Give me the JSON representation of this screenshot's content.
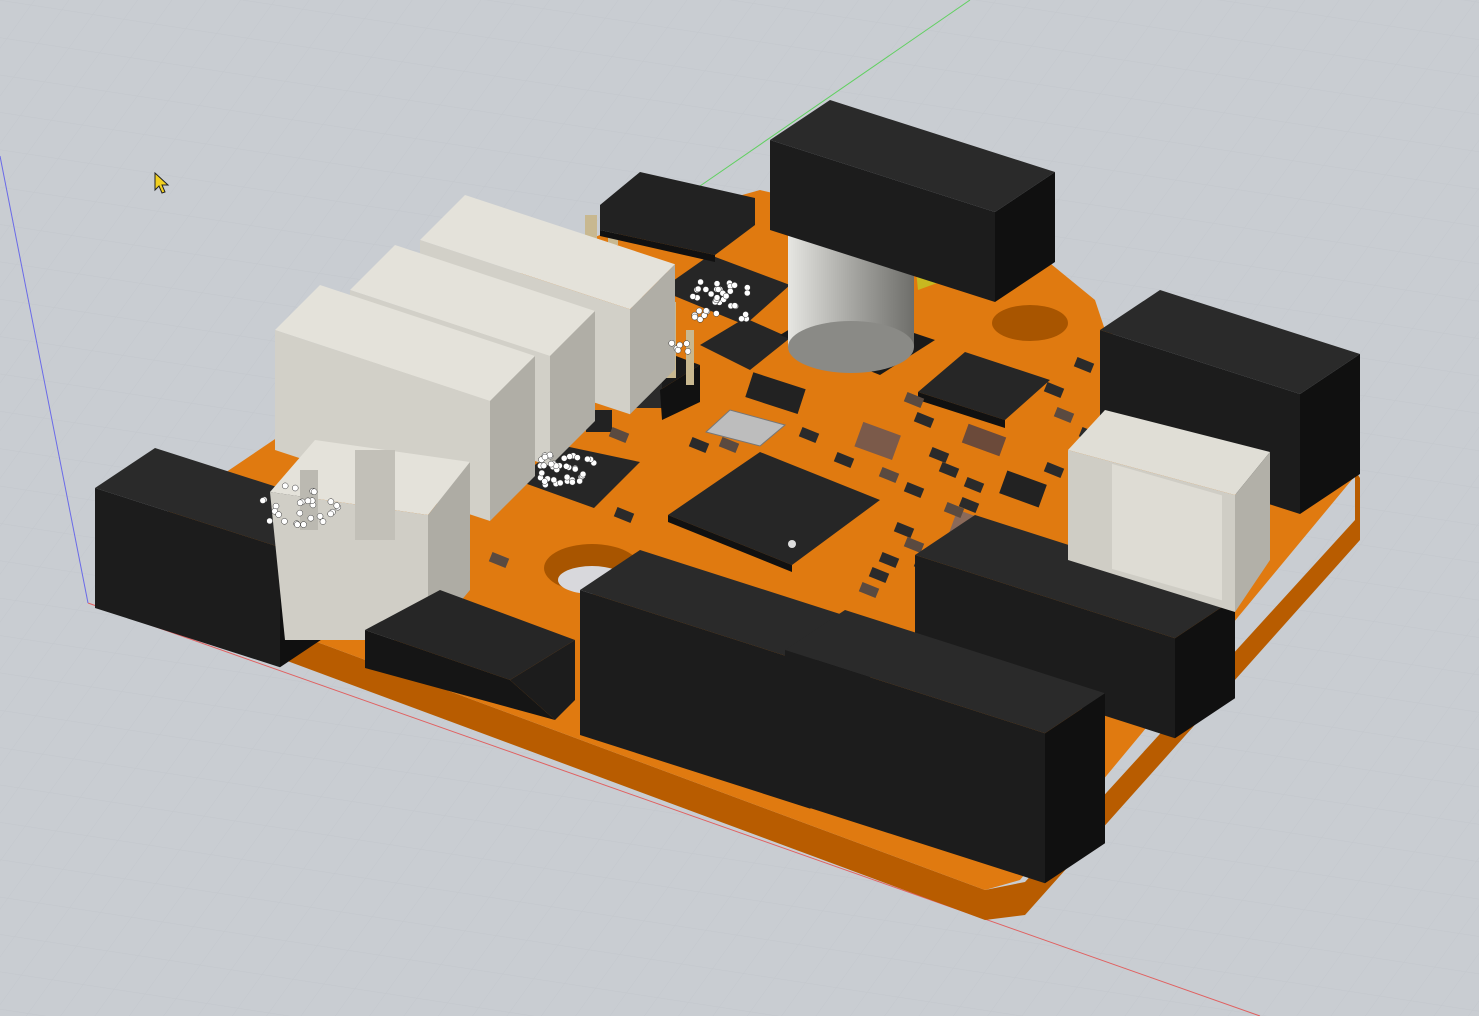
{
  "viewport": {
    "background_color": "#c9cdd2",
    "grid_color": "#bfc3c8",
    "axis_colors": {
      "x": "#e06060",
      "y": "#60d060",
      "z": "#6a6ae8"
    }
  },
  "board": {
    "pcb_color": "#e07a10",
    "pcb_edge_color": "#b85c00",
    "connector_black": "#1c1c1c",
    "connector_gray": "#d2d0c8",
    "capacitor_color": "#b8b8b4",
    "chip_color": "#262626"
  },
  "cursor": {
    "icon": "mouse-pointer-icon",
    "color": "#f2d020"
  }
}
